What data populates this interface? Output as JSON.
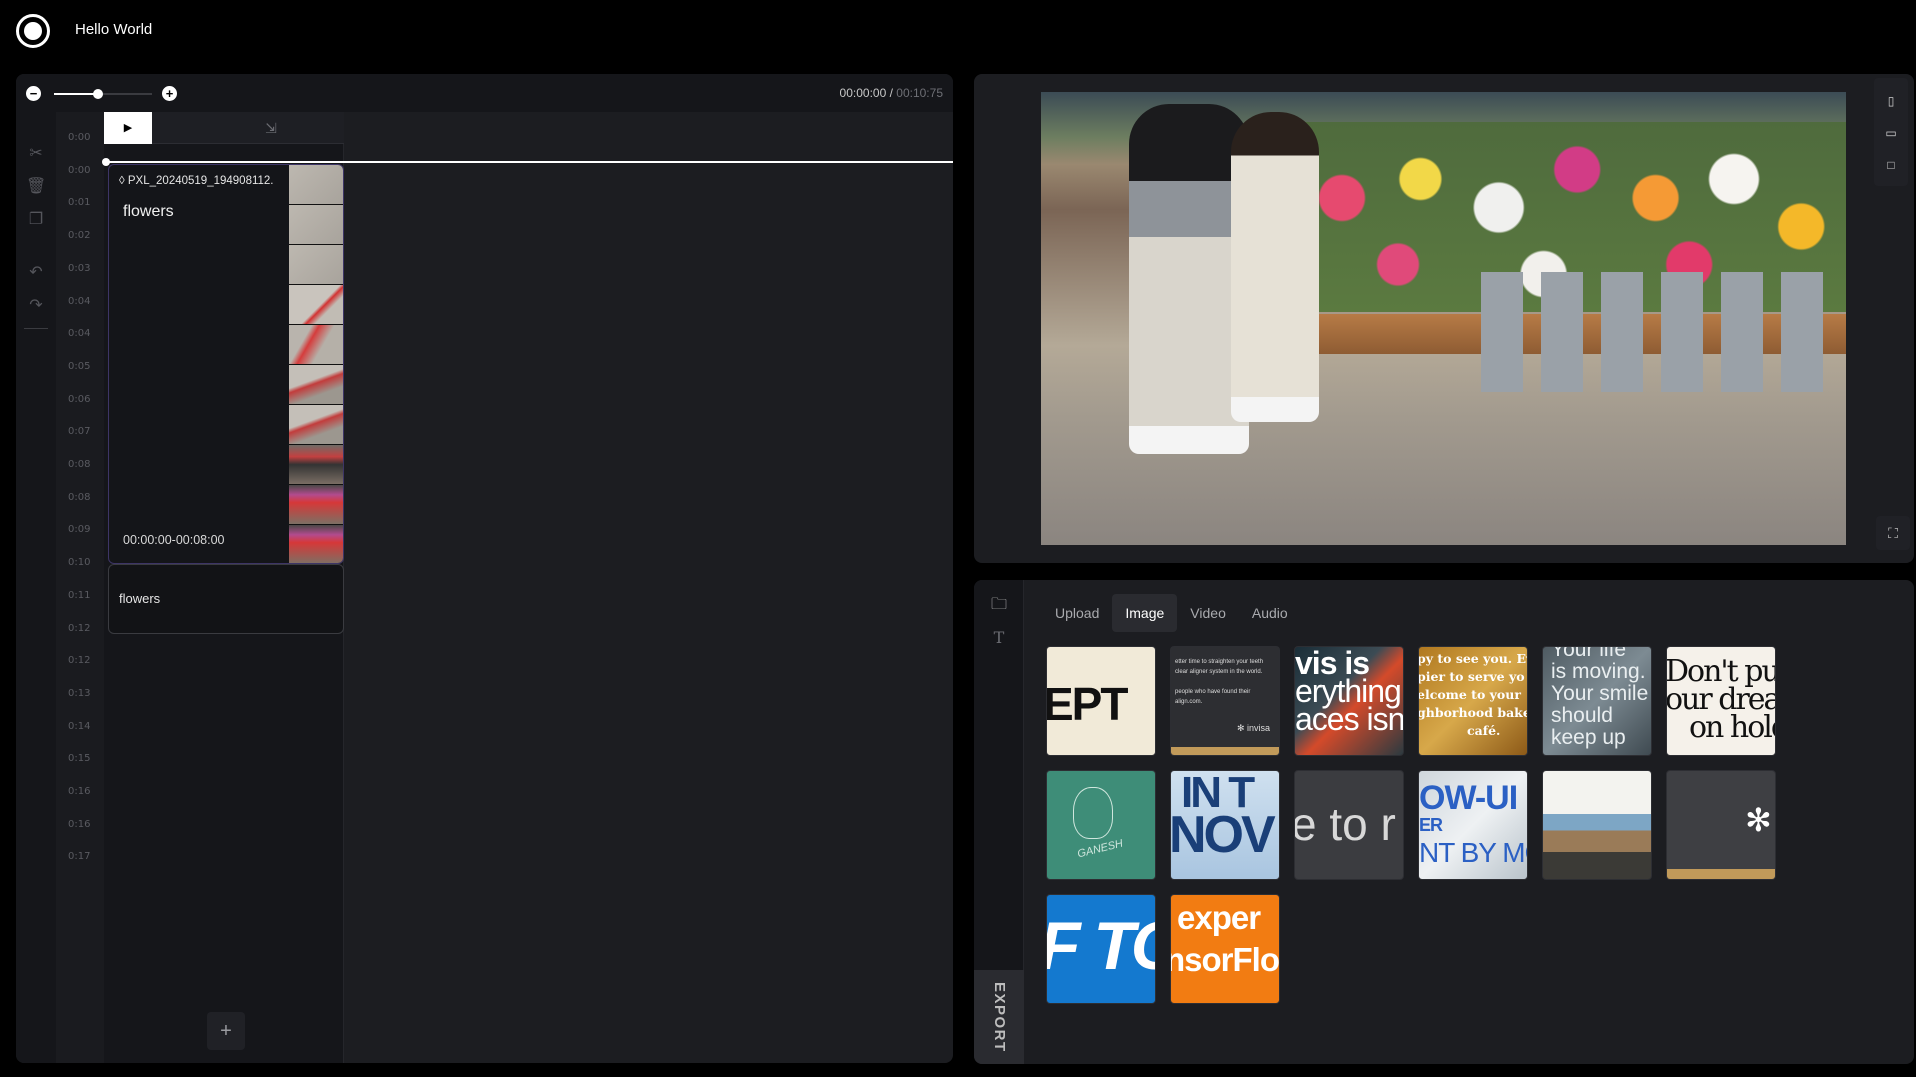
{
  "app": {
    "title": "Hello World"
  },
  "timeline": {
    "timecode_current": "00:00:00",
    "timecode_sep": " / ",
    "timecode_total": "00:10:75",
    "zoom_level": 0.45,
    "play_label": "▶",
    "ruler_ticks": [
      "0:00",
      "0:00",
      "0:01",
      "0:02",
      "0:03",
      "0:04",
      "0:04",
      "0:05",
      "0:06",
      "0:07",
      "0:08",
      "0:08",
      "0:09",
      "0:10",
      "0:11",
      "0:12",
      "0:12",
      "0:13",
      "0:14",
      "0:15",
      "0:16",
      "0:16",
      "0:17"
    ],
    "clip": {
      "file_name": "PXL_20240519_194908112.",
      "title": "flowers",
      "range": "00:00:00-00:08:00"
    },
    "text_clip": {
      "label": "flowers"
    },
    "add_track_label": "+"
  },
  "media": {
    "tabs": [
      {
        "label": "Upload",
        "active": false
      },
      {
        "label": "Image",
        "active": true
      },
      {
        "label": "Video",
        "active": false
      },
      {
        "label": "Audio",
        "active": false
      }
    ],
    "export_label": "EXPORT",
    "thumbnails": {
      "t1": "EPT",
      "t2_lines": [
        "etter time to straighten your teeth",
        "clear aligner system in the world.",
        "",
        "people who have found their",
        "align.com."
      ],
      "t2_brand": "✻ invisa",
      "t3_lines": [
        "vis is",
        "erything",
        "aces isn"
      ],
      "t4_lines": [
        "py to see you. Ev",
        "pier to serve yo",
        "elcome to your",
        "ghborhood bake",
        "café."
      ],
      "t5_lines": [
        "Your life",
        "is moving.",
        "Your smile",
        "should",
        "keep up"
      ],
      "t6_lines": [
        "Don't pu",
        "our dream",
        "on hold."
      ],
      "t7": "GANESH",
      "t8_lines": [
        "IN T",
        "NOV"
      ],
      "t9": "e to r",
      "t10_lines": [
        "OW-UI",
        "ER",
        "NT BY MC"
      ],
      "t12": "✻",
      "t13": "F TO",
      "t14_lines": [
        "exper",
        "nsorFlo"
      ]
    }
  },
  "colors": {
    "accent": "#3d3566",
    "tab_active_bg": "#2a2b30",
    "background": "#000000"
  }
}
